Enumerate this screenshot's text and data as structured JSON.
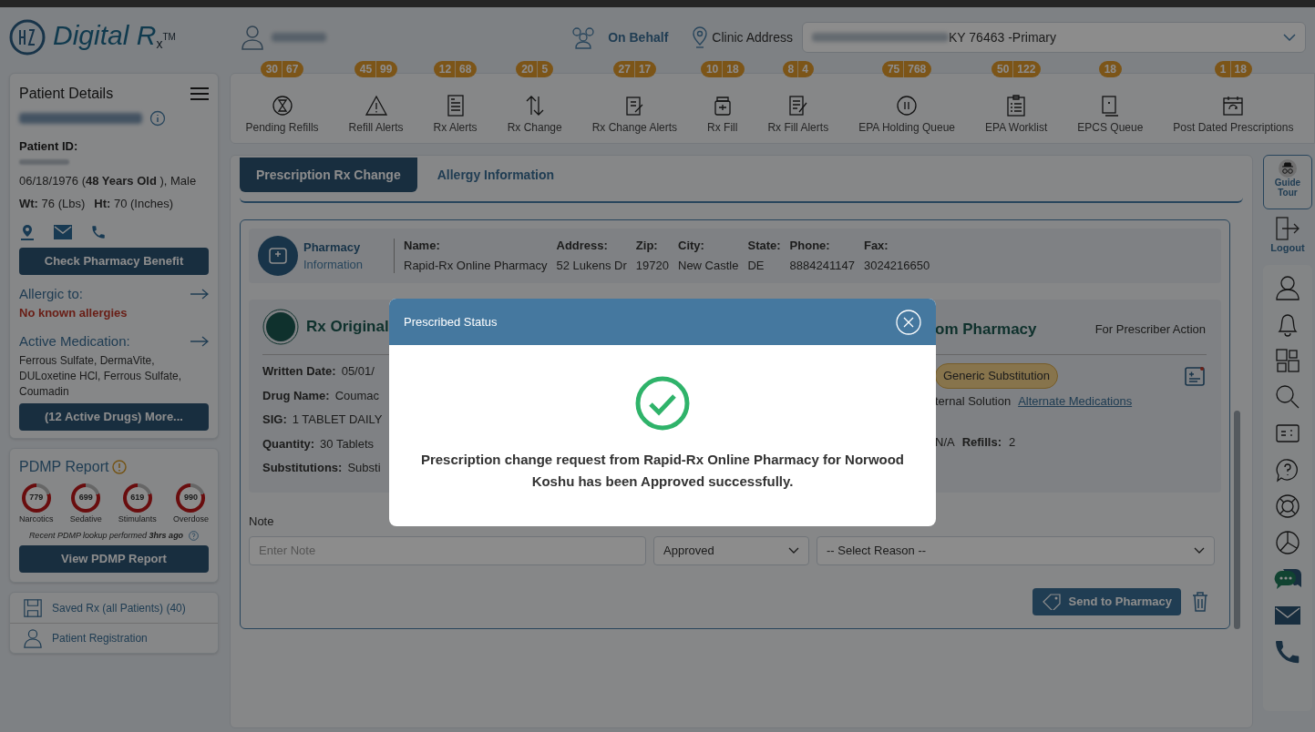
{
  "header": {
    "logo_text": "Digital R",
    "logo_sub": "x",
    "logo_tm": "TM",
    "on_behalf": "On Behalf",
    "clinic_label": "Clinic Address",
    "clinic_value": "KY 76463 -Primary"
  },
  "toolbar": [
    {
      "label": "Pending Refills",
      "counts": [
        "30",
        "67"
      ]
    },
    {
      "label": "Refill Alerts",
      "counts": [
        "45",
        "99"
      ]
    },
    {
      "label": "Rx Alerts",
      "counts": [
        "12",
        "68"
      ]
    },
    {
      "label": "Rx Change",
      "counts": [
        "20",
        "5"
      ]
    },
    {
      "label": "Rx Change Alerts",
      "counts": [
        "27",
        "17"
      ]
    },
    {
      "label": "Rx Fill",
      "counts": [
        "10",
        "18"
      ]
    },
    {
      "label": "Rx Fill Alerts",
      "counts": [
        "8",
        "4"
      ]
    },
    {
      "label": "EPA Holding Queue",
      "counts": [
        "75",
        "768"
      ]
    },
    {
      "label": "EPA Worklist",
      "counts": [
        "50",
        "122"
      ]
    },
    {
      "label": "EPCS Queue",
      "counts": [
        "18"
      ]
    },
    {
      "label": "Post Dated Prescriptions",
      "counts": [
        "1",
        "18"
      ]
    }
  ],
  "patient": {
    "title": "Patient Details",
    "id_label": "Patient ID:",
    "dob": "06/18/1976 (**48 Years Old** ), Male",
    "wt_label": "Wt:",
    "wt": "76 (Lbs)",
    "ht_label": "Ht:",
    "ht": "70 (Inches)",
    "benefit_button": "Check Pharmacy Benefit",
    "allergic_label": "Allergic to:",
    "allergies": "No known allergies",
    "meds_label": "Active Medication:",
    "meds": "Ferrous Sulfate, DermaVite, DULoxetine HCl, Ferrous Sulfate, Coumadin",
    "more_button": "(12 Active Drugs) More..."
  },
  "pdmp": {
    "title": "PDMP Report",
    "scores": [
      {
        "value": "779",
        "label": "Narcotics"
      },
      {
        "value": "699",
        "label": "Sedative"
      },
      {
        "value": "619",
        "label": "Stimulants"
      },
      {
        "value": "990",
        "label": "Overdose"
      }
    ],
    "lookup": "Recent PDMP lookup performed **3hrs ago**",
    "button": "View PDMP Report"
  },
  "side_links": [
    {
      "label": "Saved Rx (all Patients) (40)"
    },
    {
      "label": "Patient Registration"
    }
  ],
  "tabs": [
    {
      "label": "Prescription Rx Change",
      "selected": true
    },
    {
      "label": "Allergy Information",
      "selected": false
    }
  ],
  "pharmacy": {
    "title": "Pharmacy",
    "subtitle": "Information",
    "fields": [
      {
        "label": "Name:",
        "value": "Rapid-Rx Online Pharmacy"
      },
      {
        "label": "Address:",
        "value": "52 Lukens Dr"
      },
      {
        "label": "Zip:",
        "value": "19720"
      },
      {
        "label": "City:",
        "value": "New Castle"
      },
      {
        "label": "State:",
        "value": "DE"
      },
      {
        "label": "Phone:",
        "value": "8884241147"
      },
      {
        "label": "Fax:",
        "value": "3024216650"
      }
    ]
  },
  "rx_card": {
    "left_title": "Rx Original",
    "right_title": "om Pharmacy",
    "right_note": "For Prescriber Action",
    "left_rows": [
      {
        "label": "Written Date:",
        "value": "05/01/"
      },
      {
        "label": "Drug Name:",
        "value": "Coumac"
      },
      {
        "label": "SIG:",
        "value": "1 TABLET DAILY"
      },
      {
        "label": "Quantity:",
        "value": "30 Tablets"
      },
      {
        "label": "Substitutions:",
        "value": "Substi"
      }
    ],
    "badge": "Generic Substitution",
    "right_text": "ternal Solution",
    "link": "Alternate Medications",
    "na": "N/A",
    "refills_label": "Refills:",
    "refills": "2"
  },
  "form": {
    "note_label": "Note",
    "note_placeholder": "Enter Note",
    "status": "Approved",
    "reason": "-- Select Reason --",
    "send_button": "Send to Pharmacy"
  },
  "rail": {
    "guide": "Guide Tour",
    "logout": "Logout"
  },
  "modal": {
    "title": "Prescribed Status",
    "message": "Prescription change request from Rapid-Rx Online Pharmacy for Norwood Koshu has been Approved successfully."
  }
}
